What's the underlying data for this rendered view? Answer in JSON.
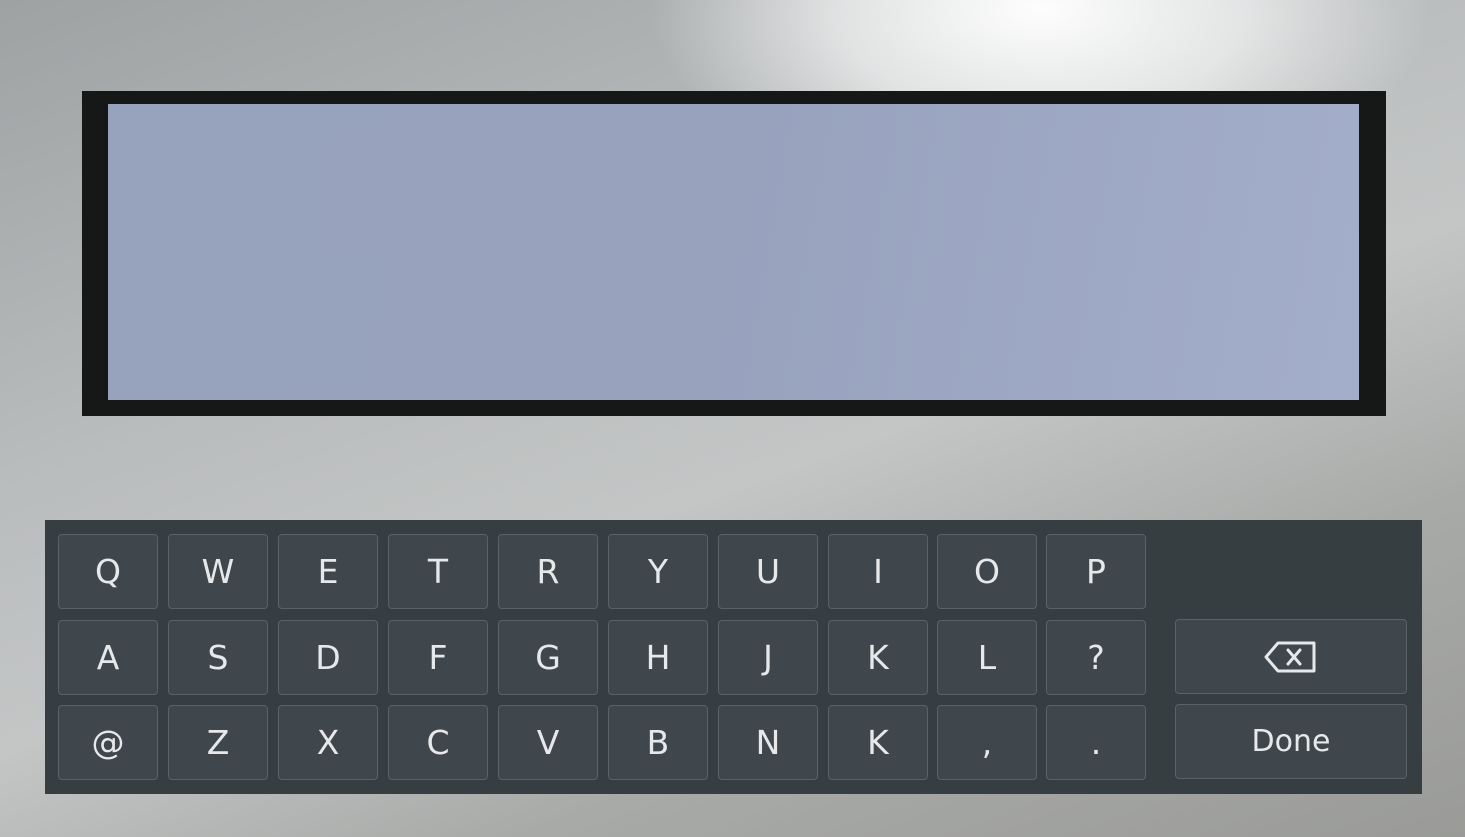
{
  "display": {
    "text": ""
  },
  "keyboard": {
    "rows": [
      [
        "Q",
        "W",
        "E",
        "T",
        "R",
        "Y",
        "U",
        "I",
        "O",
        "P"
      ],
      [
        "A",
        "S",
        "D",
        "F",
        "G",
        "H",
        "J",
        "K",
        "L",
        "?"
      ],
      [
        "@",
        "Z",
        "X",
        "C",
        "V",
        "B",
        "N",
        "K",
        ",",
        "."
      ]
    ],
    "backspace_icon": "backspace-icon",
    "done_label": "Done"
  }
}
